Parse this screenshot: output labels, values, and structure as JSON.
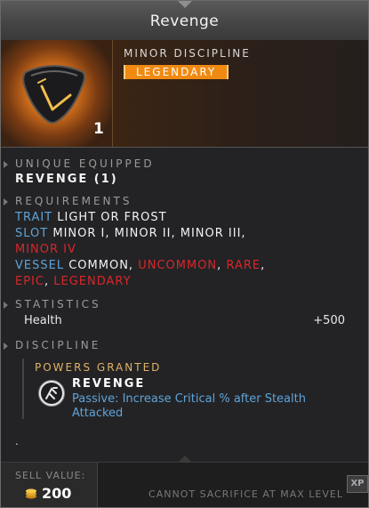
{
  "item": {
    "title": "Revenge",
    "subtype": "MINOR DISCIPLINE",
    "rarity": "LEGENDARY",
    "count": "1",
    "icon": "dark-shield-gem-icon"
  },
  "sections": {
    "unique_header": "UNIQUE EQUIPPED",
    "unique_value": "REVENGE (1)",
    "requirements_header": "REQUIREMENTS",
    "statistics_header": "STATISTICS",
    "discipline_header": "DISCIPLINE"
  },
  "requirements": {
    "trait_label": "TRAIT",
    "trait_value": "LIGHT OR FROST",
    "slot_label": "SLOT",
    "slot_value": "MINOR I, MINOR II, MINOR III,",
    "slot_value_red": "MINOR IV",
    "vessel_label": "VESSEL",
    "vessel_common": "COMMON",
    "vessel_uncommon": "UNCOMMON",
    "vessel_rare": "RARE",
    "vessel_epic": "EPIC",
    "vessel_legendary": "LEGENDARY",
    "comma": ",",
    "comma_space": ", "
  },
  "statistics": {
    "label": "Health",
    "value": "+500"
  },
  "powers": {
    "header": "POWERS GRANTED",
    "name": "REVENGE",
    "description": "Passive: Increase Critical % after Stealth Attacked",
    "icon": "revenge-power-icon"
  },
  "misc": {
    "dot": "."
  },
  "footer": {
    "sell_label": "SELL VALUE:",
    "sell_value": "200",
    "sacrifice_text": "CANNOT SACRIFICE AT MAX LEVEL",
    "xp_badge": "XP"
  },
  "colors": {
    "legendary": "#f08a12",
    "requirement_blue": "#5fa3d8",
    "unmet_red": "#d9262a",
    "powers_gold": "#e0b266"
  }
}
